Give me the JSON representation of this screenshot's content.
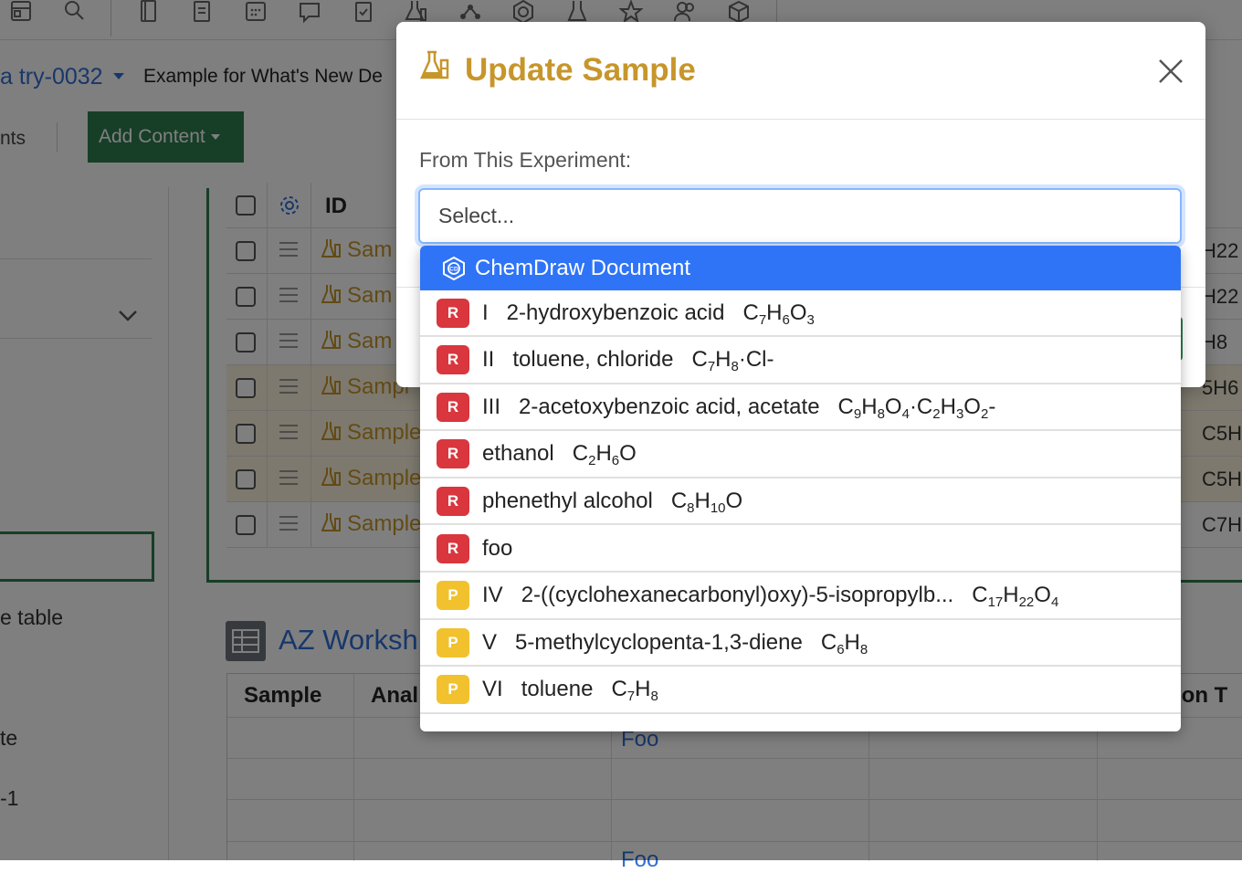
{
  "breadcrumb": {
    "id": "a try-0032",
    "title": "Example for What's New De"
  },
  "tabs": {
    "partial_tab": "nts",
    "add_content": "Add Content"
  },
  "sidebar": {
    "texts": [
      "e table",
      "te",
      "-1"
    ]
  },
  "sample_table": {
    "header_id": "ID",
    "rows": [
      {
        "label": "Sam",
        "right": "H22",
        "highlight": false
      },
      {
        "label": "Sam",
        "right": "H22",
        "highlight": false
      },
      {
        "label": "Sam",
        "right": "H8",
        "highlight": false
      },
      {
        "label": "Sampl",
        "right": "5H6",
        "highlight": true
      },
      {
        "label": "Sample",
        "right": "C5H6",
        "highlight": true
      },
      {
        "label": "Sample",
        "right": "C5H6",
        "highlight": true
      },
      {
        "label": "Sample",
        "right": "C7H8",
        "highlight": false
      }
    ]
  },
  "az_worksheet": {
    "title": "AZ Worksh",
    "headers": [
      "Sample",
      "Anal",
      "tion T"
    ],
    "cells": [
      "Foo",
      "Foo"
    ]
  },
  "modal": {
    "title": "Update Sample",
    "label": "From This Experiment:",
    "select_placeholder": "Select..."
  },
  "dropdown": {
    "header_option": "ChemDraw Document",
    "options": [
      {
        "badge": "R",
        "type": "reactant",
        "roman": "I",
        "name": "2-hydroxybenzoic acid",
        "formula": "C7H6O3"
      },
      {
        "badge": "R",
        "type": "reactant",
        "roman": "II",
        "name": "toluene, chloride",
        "formula": "C7H8·Cl-"
      },
      {
        "badge": "R",
        "type": "reactant",
        "roman": "III",
        "name": "2-acetoxybenzoic acid, acetate",
        "formula": "C9H8O4·C2H3O2-"
      },
      {
        "badge": "R",
        "type": "reactant",
        "roman": "",
        "name": "ethanol",
        "formula": "C2H6O"
      },
      {
        "badge": "R",
        "type": "reactant",
        "roman": "",
        "name": "phenethyl alcohol",
        "formula": "C8H10O"
      },
      {
        "badge": "R",
        "type": "reactant",
        "roman": "",
        "name": "foo",
        "formula": ""
      },
      {
        "badge": "P",
        "type": "product",
        "roman": "IV",
        "name": "2-((cyclohexanecarbonyl)oxy)-5-isopropylb...",
        "formula": "C17H22O4"
      },
      {
        "badge": "P",
        "type": "product",
        "roman": "V",
        "name": "5-methylcyclopenta-1,3-diene",
        "formula": "C6H8"
      },
      {
        "badge": "P",
        "type": "product",
        "roman": "VI",
        "name": "toluene",
        "formula": "C7H8"
      }
    ]
  },
  "colors": {
    "accent_gold": "#c7962b",
    "primary_blue": "#2f74f6",
    "success_green": "#2e7d4f",
    "reactant_badge": "#d9363e",
    "product_badge": "#f2c12e"
  }
}
